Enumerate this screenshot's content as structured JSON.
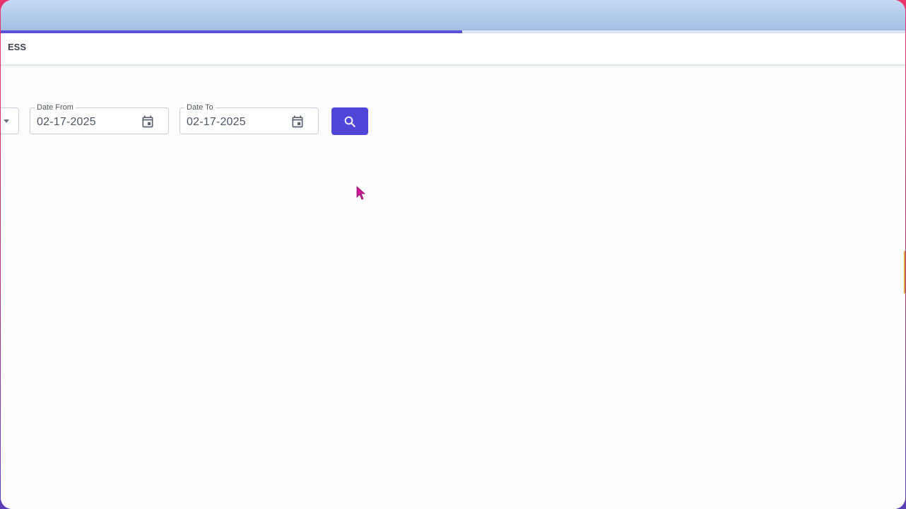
{
  "header": {
    "title": "ESS"
  },
  "loading": {
    "progress_percent": 51
  },
  "filters": {
    "date_from": {
      "label": "Date From",
      "value": "02-17-2025"
    },
    "date_to": {
      "label": "Date To",
      "value": "02-17-2025"
    }
  },
  "search_button": {
    "icon": "search-icon",
    "color": "#4f46d8"
  },
  "colors": {
    "accent": "#5c4fd8"
  }
}
